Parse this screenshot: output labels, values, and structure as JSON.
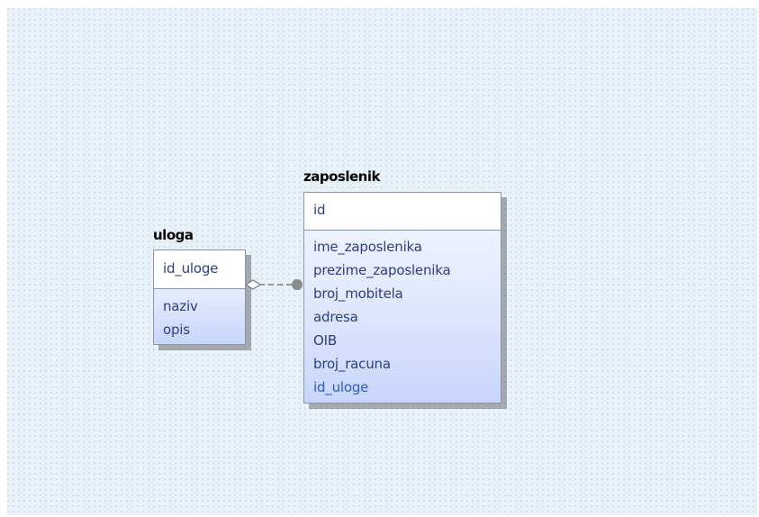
{
  "entities": {
    "uloga": {
      "name": "uloga",
      "primary_keys": [
        "id_uloge"
      ],
      "attributes": [
        "naziv",
        "opis"
      ]
    },
    "zaposlenik": {
      "name": "zaposlenik",
      "primary_keys": [
        "id"
      ],
      "attributes": [
        "ime_zaposlenika",
        "prezime_zaposlenika",
        "broj_mobitela",
        "adresa",
        "OIB",
        "broj_racuna",
        "id_uloge"
      ]
    }
  },
  "colors": {
    "canvas": "#eaf2f9",
    "attribute_text": "#2c3e86",
    "foreign_key_text": "#2a5bd0",
    "border": "#8a96ad"
  }
}
